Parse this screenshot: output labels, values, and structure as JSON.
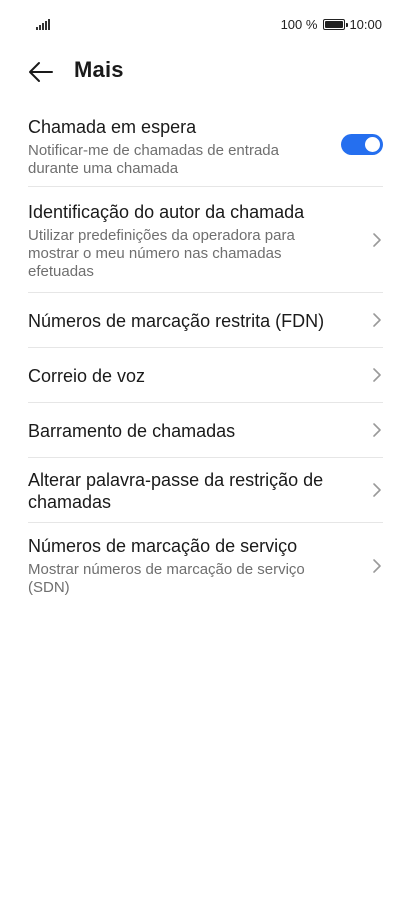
{
  "status": {
    "battery_percent": "100 %",
    "time": "10:00",
    "signal_icon": "signal-icon",
    "battery_icon": "battery-icon"
  },
  "header": {
    "title": "Mais",
    "back_icon": "arrow-left-icon"
  },
  "items": [
    {
      "title": "Chamada em espera",
      "subtitle": "Notificar-me de chamadas de entrada durante uma chamada",
      "control": "toggle",
      "toggle_on": true,
      "accent": "#256fef"
    },
    {
      "title": "Identificação do autor da chamada",
      "subtitle": "Utilizar predefinições da operadora para mostrar o meu número nas chamadas efetuadas",
      "control": "chevron"
    },
    {
      "title": "Números de marcação restrita (FDN)",
      "control": "chevron"
    },
    {
      "title": "Correio de voz",
      "control": "chevron"
    },
    {
      "title": "Barramento de chamadas",
      "control": "chevron"
    },
    {
      "title": "Alterar palavra-passe da restrição de chamadas",
      "control": "chevron"
    },
    {
      "title": "Números de marcação de serviço",
      "subtitle": "Mostrar números de marcação de serviço (SDN)",
      "control": "chevron"
    }
  ]
}
